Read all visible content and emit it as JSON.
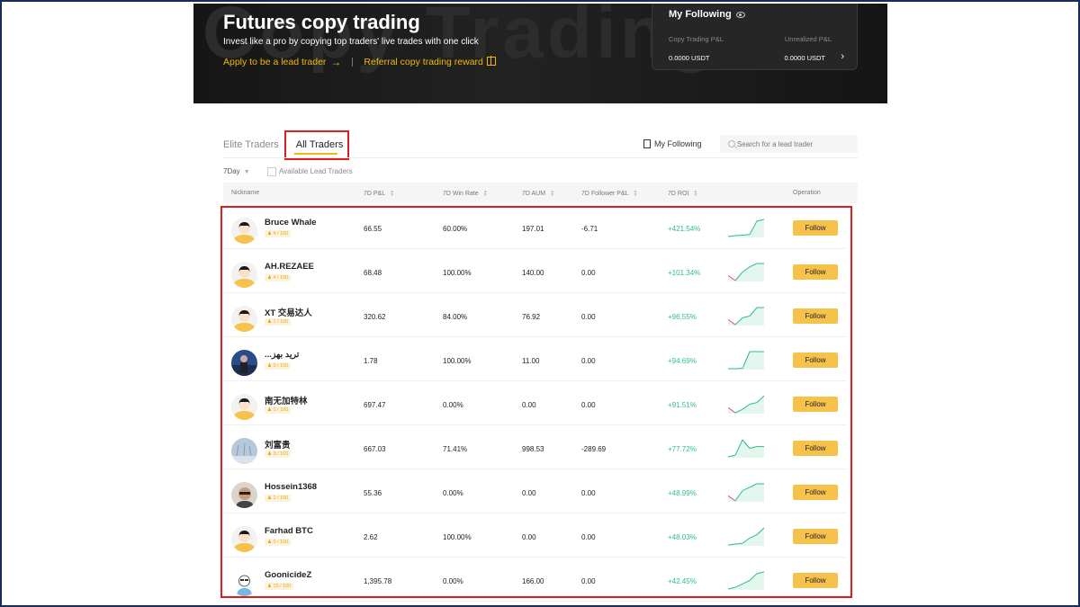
{
  "hero": {
    "watermark": "Copy Trading",
    "title": "Futures copy trading",
    "subtitle": "Invest like a pro by copying top traders' live trades with one click",
    "apply_link": "Apply to be a lead trader",
    "apply_arrow": "→",
    "referral_link": "Referral copy trading reward"
  },
  "following_card": {
    "title": "My Following",
    "pnl_label": "Copy Trading P&L",
    "unrealized_label": "Unrealized P&L",
    "pnl_value": "0.0000 USDT",
    "unrealized_value": "0.0000 USDT",
    "arrow": "›"
  },
  "tabs": {
    "elite": "Elite Traders",
    "all": "All Traders"
  },
  "my_following": "My Following",
  "search": {
    "placeholder": "Search for a lead trader"
  },
  "filters": {
    "period": "7Day",
    "available_label": "Available Lead Traders"
  },
  "columns": {
    "nickname": "Nickname",
    "pnl": "7D P&L",
    "win_rate": "7D Win Rate",
    "aum": "7D AUM",
    "follower_pnl": "7D Follower P&L",
    "roi": "7D ROI",
    "operation": "Operation"
  },
  "follow_label": "Follow",
  "traders": [
    {
      "name": "Bruce Whale",
      "followers": "4 / 100",
      "pnl": "66.55",
      "win": "60.00%",
      "aum": "197.01",
      "fpnl": "-6.71",
      "roi": "+421.54%",
      "avatar": "default",
      "spark": [
        0,
        0.05,
        0.08,
        0.12,
        0.9,
        1
      ]
    },
    {
      "name": "AH.REZAEE",
      "followers": "4 / 100",
      "pnl": "68.48",
      "win": "100.00%",
      "aum": "140.00",
      "fpnl": "0.00",
      "roi": "+101.34%",
      "avatar": "default",
      "spark": [
        0.3,
        0,
        0.5,
        0.8,
        1,
        1
      ]
    },
    {
      "name": "XT 交易达人",
      "followers": "1 / 100",
      "pnl": "320.62",
      "win": "84.00%",
      "aum": "76.92",
      "fpnl": "0.00",
      "roi": "+96.55%",
      "avatar": "default",
      "spark": [
        0.3,
        0,
        0.4,
        0.5,
        1,
        1
      ]
    },
    {
      "name": "...ترید بهز",
      "followers": "0 / 100",
      "pnl": "1.78",
      "win": "100.00%",
      "aum": "11.00",
      "fpnl": "0.00",
      "roi": "+94.69%",
      "avatar": "photo-blue",
      "spark": [
        0,
        0,
        0.02,
        1,
        1,
        1
      ]
    },
    {
      "name": "南无加特林",
      "followers": "1 / 100",
      "pnl": "697.47",
      "win": "0.00%",
      "aum": "0.00",
      "fpnl": "0.00",
      "roi": "+91.51%",
      "avatar": "default",
      "spark": [
        0.3,
        0,
        0.2,
        0.5,
        0.6,
        1
      ]
    },
    {
      "name": "刘富贵",
      "followers": "3 / 100",
      "pnl": "667.03",
      "win": "71.41%",
      "aum": "998.53",
      "fpnl": "-289.69",
      "roi": "+77.72%",
      "avatar": "photo-sky",
      "spark": [
        0,
        0.1,
        1,
        0.5,
        0.6,
        0.6
      ]
    },
    {
      "name": "Hossein1368",
      "followers": "2 / 100",
      "pnl": "55.36",
      "win": "0.00%",
      "aum": "0.00",
      "fpnl": "0.00",
      "roi": "+48.99%",
      "avatar": "photo-face",
      "spark": [
        0.3,
        0,
        0.6,
        0.8,
        1,
        1
      ]
    },
    {
      "name": "Farhad BTC",
      "followers": "0 / 100",
      "pnl": "2.62",
      "win": "100.00%",
      "aum": "0.00",
      "fpnl": "0.00",
      "roi": "+48.03%",
      "avatar": "default",
      "spark": [
        0,
        0.05,
        0.1,
        0.4,
        0.6,
        1
      ]
    },
    {
      "name": "GoonicideZ",
      "followers": "15 / 100",
      "pnl": "1,395.78",
      "win": "0.00%",
      "aum": "166.00",
      "fpnl": "0.00",
      "roi": "+42.45%",
      "avatar": "cartoon",
      "spark": [
        0,
        0.1,
        0.3,
        0.5,
        0.9,
        1
      ]
    }
  ],
  "colors": {
    "accent": "#f0b90b",
    "follow_button": "#f7c24c",
    "roi_green": "#2fbd85",
    "loss_red": "#f6465d",
    "highlight": "#e01c1c"
  }
}
